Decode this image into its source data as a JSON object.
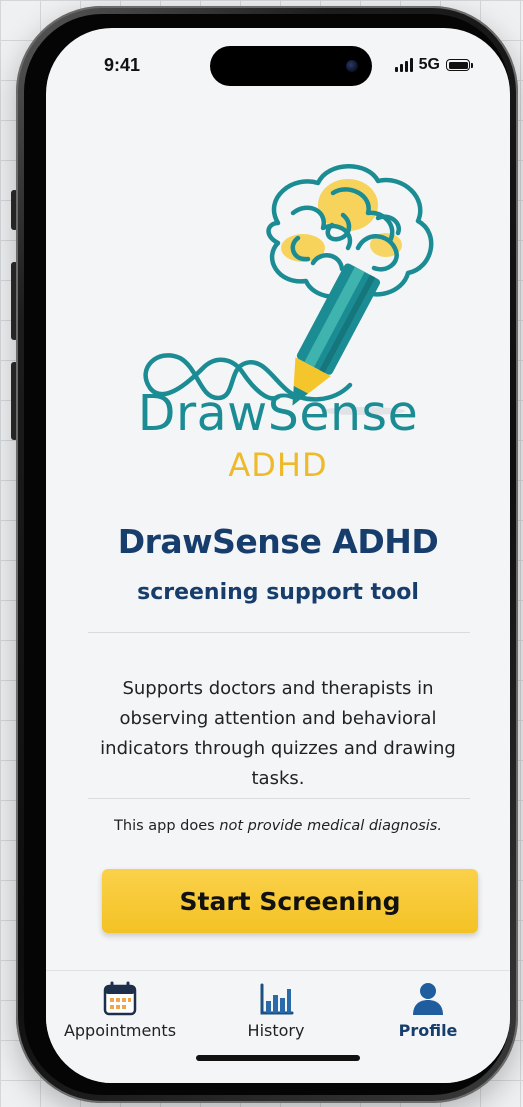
{
  "status_bar": {
    "time": "9:41",
    "network": "5G",
    "battery_level": 1.0
  },
  "logo": {
    "wordmark": "DrawSense",
    "wordmark_sub": "ADHD",
    "icon": "brain-pencil-logo",
    "colors": {
      "teal": "#1b8c93",
      "gold": "#efba2a"
    }
  },
  "header": {
    "title": "DrawSense ADHD",
    "subtitle": "screening support tool"
  },
  "main": {
    "description": "Supports doctors and therapists in observing attention and behavioral indicators through quizzes and drawing tasks.",
    "disclaimer_prefix": "This app does ",
    "disclaimer_emphasis": "not provide medical diagnosis."
  },
  "actions": {
    "start_label": "Start Screening",
    "start_color": "#f5c52c"
  },
  "tab_bar": {
    "active_color": "#173d6c",
    "items": [
      {
        "label": "Appointments",
        "icon": "calendar-icon",
        "active": false
      },
      {
        "label": "History",
        "icon": "bar-chart-icon",
        "active": false
      },
      {
        "label": "Profile",
        "icon": "user-icon",
        "active": true
      }
    ]
  }
}
